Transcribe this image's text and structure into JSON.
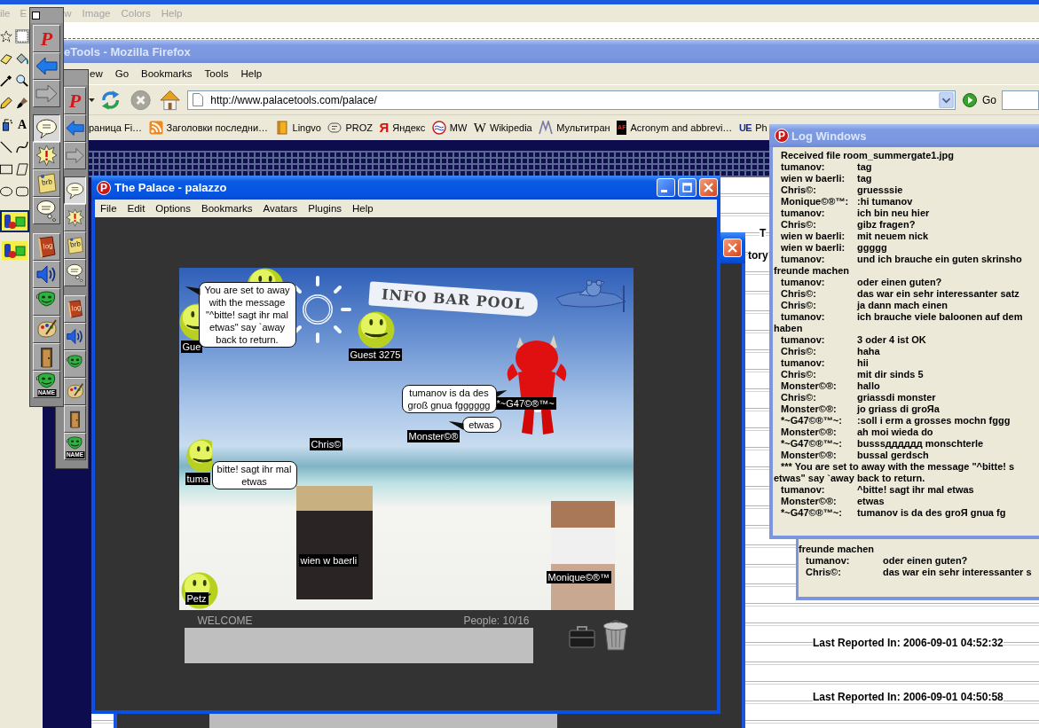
{
  "paint": {
    "menu": [
      "ile",
      "E",
      "w",
      "Image",
      "Colors",
      "Help"
    ],
    "tools": [
      {
        "kind": "free-select",
        "selected": false
      },
      {
        "kind": "select",
        "selected": true
      },
      {
        "kind": "eraser",
        "selected": false
      },
      {
        "kind": "fill",
        "selected": false
      },
      {
        "kind": "picker",
        "selected": false
      },
      {
        "kind": "magnifier",
        "selected": false
      },
      {
        "kind": "pencil",
        "selected": false
      },
      {
        "kind": "brush",
        "selected": false
      },
      {
        "kind": "airbrush",
        "selected": false
      },
      {
        "kind": "text",
        "glyph": "A",
        "selected": false
      },
      {
        "kind": "line",
        "selected": false
      },
      {
        "kind": "curve",
        "selected": false
      },
      {
        "kind": "rectangle",
        "selected": false
      },
      {
        "kind": "polygon",
        "selected": false
      },
      {
        "kind": "ellipse",
        "selected": false
      },
      {
        "kind": "rounded-rectangle",
        "selected": false
      }
    ],
    "options": [
      {
        "selected": true
      },
      {
        "selected": false
      }
    ]
  },
  "browser": {
    "title": "eTools - Mozilla Firefox",
    "menu": [
      "ew",
      "Go",
      "Bookmarks",
      "Tools",
      "Help"
    ],
    "nav": [
      {
        "kind": "history",
        "disabled": false
      },
      {
        "kind": "reload",
        "disabled": false
      },
      {
        "kind": "stop",
        "disabled": true
      },
      {
        "kind": "home",
        "disabled": false
      }
    ],
    "url": "http://www.palacetools.com/palace/",
    "go": "Go",
    "bookmarks": [
      {
        "kind": "none",
        "label": "раница Fi…"
      },
      {
        "kind": "feed",
        "label": "Заголовки последни…"
      },
      {
        "kind": "book",
        "label": "Lingvo"
      },
      {
        "kind": "proz",
        "label": "PROZ"
      },
      {
        "kind": "ya",
        "glyph": "Я",
        "label": "Яндекс"
      },
      {
        "kind": "mw",
        "label": "MW"
      },
      {
        "kind": "wiki",
        "glyph": "W",
        "label": "Wikipedia"
      },
      {
        "kind": "mt",
        "label": "Мультитран"
      },
      {
        "kind": "af",
        "glyph": "AF",
        "label": "Acronym and abbrevi…"
      },
      {
        "kind": "ue",
        "glyph": "UE",
        "label": "Ph"
      }
    ],
    "page": {
      "fragments": [
        "T",
        "tory"
      ],
      "reports": [
        "Last Reported In: 2006-09-01 04:52:32",
        "Last Reported In: 2006-09-01 04:50:58"
      ]
    }
  },
  "palettes": [
    {
      "groups": [
        [
          {
            "kind": "logo",
            "label": "P",
            "selected": false,
            "disabled": false
          },
          {
            "kind": "back",
            "selected": false,
            "disabled": false
          },
          {
            "kind": "forward",
            "selected": false,
            "disabled": true
          }
        ],
        [
          {
            "kind": "say",
            "selected": true,
            "disabled": false
          },
          {
            "kind": "shout",
            "selected": false,
            "disabled": false
          },
          {
            "kind": "note",
            "label": "brb",
            "selected": false,
            "disabled": false
          },
          {
            "kind": "think",
            "selected": false,
            "disabled": false
          }
        ],
        [
          {
            "kind": "log",
            "label": "log",
            "selected": false,
            "disabled": false
          },
          {
            "kind": "sound",
            "selected": false,
            "disabled": false
          },
          {
            "kind": "mask",
            "selected": false,
            "disabled": false
          },
          {
            "kind": "palette",
            "selected": false,
            "disabled": false
          },
          {
            "kind": "door",
            "selected": false,
            "disabled": false
          },
          {
            "kind": "name",
            "label": "NAME",
            "selected": false,
            "disabled": false
          }
        ]
      ]
    },
    {
      "groups": [
        [
          {
            "kind": "logo",
            "label": "P",
            "selected": false,
            "disabled": false
          },
          {
            "kind": "back",
            "selected": false,
            "disabled": false
          },
          {
            "kind": "forward",
            "selected": false,
            "disabled": true
          }
        ],
        [
          {
            "kind": "say",
            "selected": true,
            "disabled": false
          },
          {
            "kind": "shout",
            "selected": false,
            "disabled": false
          },
          {
            "kind": "note",
            "label": "brb",
            "selected": false,
            "disabled": false
          },
          {
            "kind": "think",
            "selected": false,
            "disabled": false
          }
        ],
        [
          {
            "kind": "log",
            "label": "log",
            "selected": false,
            "disabled": false
          },
          {
            "kind": "sound",
            "selected": false,
            "disabled": false
          },
          {
            "kind": "mask",
            "selected": false,
            "disabled": false
          },
          {
            "kind": "palette",
            "selected": false,
            "disabled": false
          },
          {
            "kind": "door",
            "selected": false,
            "disabled": false
          },
          {
            "kind": "name",
            "label": "NAME",
            "selected": false,
            "disabled": false
          }
        ]
      ]
    }
  ],
  "palace": {
    "logo": "P",
    "title": "The Palace - palazzo",
    "menu": [
      "File",
      "Edit",
      "Options",
      "Bookmarks",
      "Avatars",
      "Plugins",
      "Help"
    ],
    "room": {
      "banner": "INFO BAR POOL",
      "avatars": [
        {
          "kind": "smiley"
        },
        {
          "kind": "smiley",
          "name": "Gue"
        },
        {
          "kind": "smiley",
          "name": "Guest 3275"
        },
        {
          "kind": "devil",
          "name": "*~G47©®™~"
        },
        {
          "kind": "nametag",
          "name": "Monster©®"
        },
        {
          "kind": "nametag",
          "name": "Chris©"
        },
        {
          "kind": "smiley",
          "name": "tuma"
        },
        {
          "kind": "photo",
          "name": "wien w baerli"
        },
        {
          "kind": "photo",
          "name": "Monique©®™"
        },
        {
          "kind": "smiley",
          "name": "Petz"
        }
      ],
      "balloons": [
        {
          "text": "You are set to away with the message \"^bitte! sagt ihr mal etwas\" say `away back to return."
        },
        {
          "text": "tumanov is da des groß gnua fgggggg"
        },
        {
          "text": "etwas"
        },
        {
          "text": "bitte! sagt ihr mal etwas"
        }
      ]
    },
    "status": "WELCOME",
    "people": "People: 10/16"
  },
  "log": {
    "logo": "P",
    "title": "Log Windows",
    "lines": [
      {
        "kind": "system",
        "text": "Received file room_summergate1.jpg"
      },
      {
        "kind": "message",
        "name": "tumanov:",
        "text": "tag"
      },
      {
        "kind": "message",
        "name": "wien w baerli:",
        "text": "tag"
      },
      {
        "kind": "message",
        "name": "Chris©:",
        "text": "gruesssie"
      },
      {
        "kind": "message",
        "name": "Monique©®™:",
        "text": ":hi tumanov"
      },
      {
        "kind": "message",
        "name": "tumanov:",
        "text": "ich bin neu hier"
      },
      {
        "kind": "message",
        "name": "Chris©:",
        "text": "gibz fragen?"
      },
      {
        "kind": "message",
        "name": "wien w baerli:",
        "text": "mit neuem nick"
      },
      {
        "kind": "message",
        "name": "wien w baerli:",
        "text": "ggggg"
      },
      {
        "kind": "message",
        "name": "tumanov:",
        "text": "und ich brauche ein guten skrinsho"
      },
      {
        "kind": "wrap",
        "text": "freunde machen"
      },
      {
        "kind": "message",
        "name": "tumanov:",
        "text": "oder einen guten?"
      },
      {
        "kind": "message",
        "name": "Chris©:",
        "text": "das war ein sehr interessanter satz"
      },
      {
        "kind": "message",
        "name": "Chris©:",
        "text": "ja dann mach einen"
      },
      {
        "kind": "message",
        "name": "tumanov:",
        "text": "ich brauche viele baloonen auf dem"
      },
      {
        "kind": "wrap",
        "text": "haben"
      },
      {
        "kind": "message",
        "name": "tumanov:",
        "text": "3 oder 4 ist OK"
      },
      {
        "kind": "message",
        "name": "Chris©:",
        "text": "haha"
      },
      {
        "kind": "message",
        "name": "tumanov:",
        "text": "hii"
      },
      {
        "kind": "message",
        "name": "Chris©:",
        "text": "mit dir sinds 5"
      },
      {
        "kind": "message",
        "name": "Monster©®:",
        "text": "hallo"
      },
      {
        "kind": "message",
        "name": "Chris©:",
        "text": "griassdi monster"
      },
      {
        "kind": "message",
        "name": "Monster©®:",
        "text": "jo griass di groЯa"
      },
      {
        "kind": "message",
        "name": "*~G47©®™~:",
        "text": ":soll i erm a grosses mochn fggg"
      },
      {
        "kind": "message",
        "name": "Monster©®:",
        "text": "ah moi wieda do"
      },
      {
        "kind": "message",
        "name": "*~G47©®™~:",
        "text": "busssдддддд monschterle"
      },
      {
        "kind": "message",
        "name": "Monster©®:",
        "text": "bussal gerdsch"
      },
      {
        "kind": "system",
        "text": "*** You are set to away with the message \"^bitte! s"
      },
      {
        "kind": "wrap",
        "text": "etwas\" say `away back to return."
      },
      {
        "kind": "message",
        "name": "tumanov:",
        "text": "^bitte! sagt ihr mal etwas"
      },
      {
        "kind": "message",
        "name": "Monster©®:",
        "text": "etwas"
      },
      {
        "kind": "message",
        "name": "*~G47©®™~:",
        "text": "tumanov is da des groЯ gnua fg"
      }
    ]
  },
  "log_behind": {
    "lines": [
      {
        "kind": "wrap",
        "text": "freunde machen"
      },
      {
        "kind": "message",
        "name": "tumanov:",
        "text": "oder einen guten?"
      },
      {
        "kind": "message",
        "name": "Chris©:",
        "text": "das war ein sehr interessanter s"
      }
    ]
  }
}
